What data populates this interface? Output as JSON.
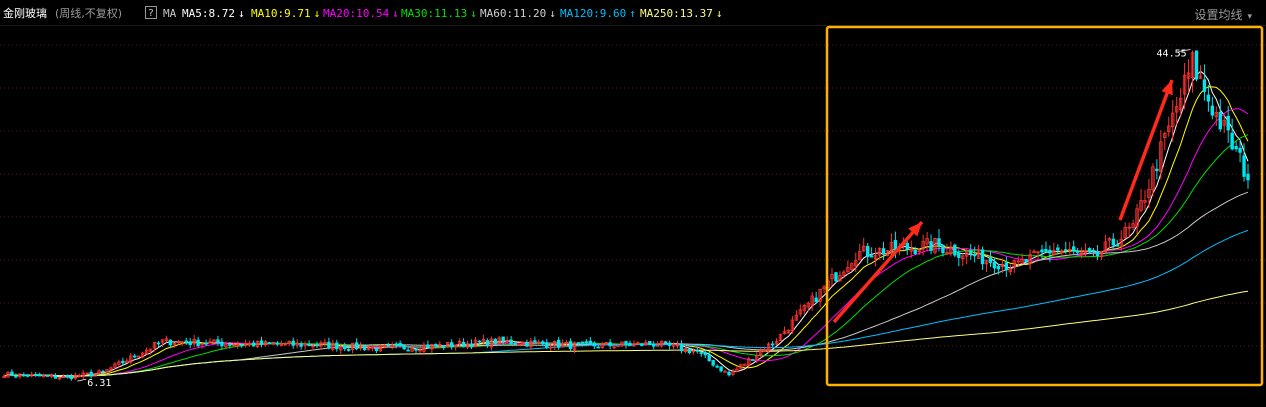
{
  "header": {
    "stock_name": "金刚玻璃",
    "period_info": "(周线,不复权)",
    "help_icon": "?",
    "ma_label": "MA",
    "indicators": [
      {
        "text": "MA5:8.72",
        "arrow": "↓",
        "color": "#ffffff"
      },
      {
        "text": "MA10:9.71",
        "arrow": "↓",
        "color": "#ffff00"
      },
      {
        "text": "MA20:10.54",
        "arrow": "↓",
        "color": "#ff00ff"
      },
      {
        "text": "MA30:11.13",
        "arrow": "↓",
        "color": "#00e000"
      },
      {
        "text": "MA60:11.20",
        "arrow": "↓",
        "color": "#d0d0d0"
      },
      {
        "text": "MA120:9.60",
        "arrow": "↑",
        "color": "#00bfff"
      },
      {
        "text": "MA250:13.37",
        "arrow": "↓",
        "color": "#ffff80"
      }
    ],
    "settings_label": "设置均线",
    "settings_icon": "dropdown-arrow-icon"
  },
  "chart_data": {
    "type": "candlestick",
    "high_label": "44.55",
    "low_label": "6.31",
    "ylim": [
      4,
      46
    ],
    "grid": "horizontal dotted",
    "colors": {
      "up": "#ff3232",
      "down": "#00e5ee",
      "highlight_box": "#ffb000",
      "arrow": "#ff2a1a"
    },
    "annotations": [
      "highlight-box-around-rally",
      "red-arrow-1",
      "red-arrow-2"
    ]
  }
}
